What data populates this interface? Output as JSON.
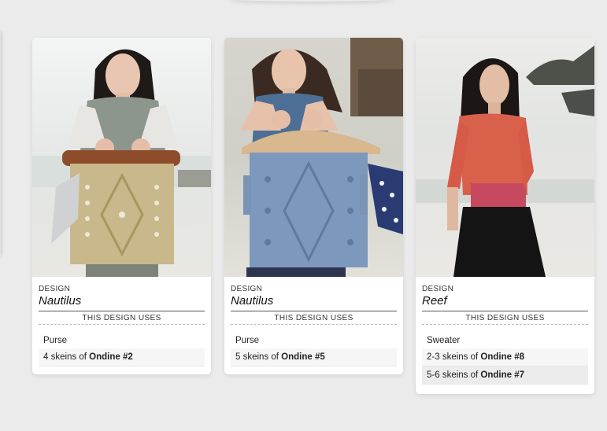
{
  "cards": [
    {
      "kicker": "DESIGN",
      "design": "Nautilus",
      "uses_label": "THIS DESIGN USES",
      "garment": "Purse",
      "yarns": [
        {
          "qty": "4 skeins of ",
          "yarn": "Ondine #2"
        }
      ],
      "photo": "model-holding-beige-knitted-purse"
    },
    {
      "kicker": "DESIGN",
      "design": "Nautilus",
      "uses_label": "THIS DESIGN USES",
      "garment": "Purse",
      "yarns": [
        {
          "qty": "5 skeins of ",
          "yarn": "Ondine #5"
        }
      ],
      "photo": "model-holding-blue-knitted-purse"
    },
    {
      "kicker": "DESIGN",
      "design": "Reef",
      "uses_label": "THIS DESIGN USES",
      "garment": "Sweater",
      "yarns": [
        {
          "qty": "2-3 skeins of ",
          "yarn": "Ondine #8"
        },
        {
          "qty": "5-6 skeins of ",
          "yarn": "Ondine #7"
        }
      ],
      "photo": "model-wearing-coral-sweater"
    }
  ],
  "colors": {
    "page_bg": "#ebebeb",
    "card_bg": "#ffffff",
    "row_bg": "#f6f6f6",
    "row_hover_bg": "#ececec"
  }
}
